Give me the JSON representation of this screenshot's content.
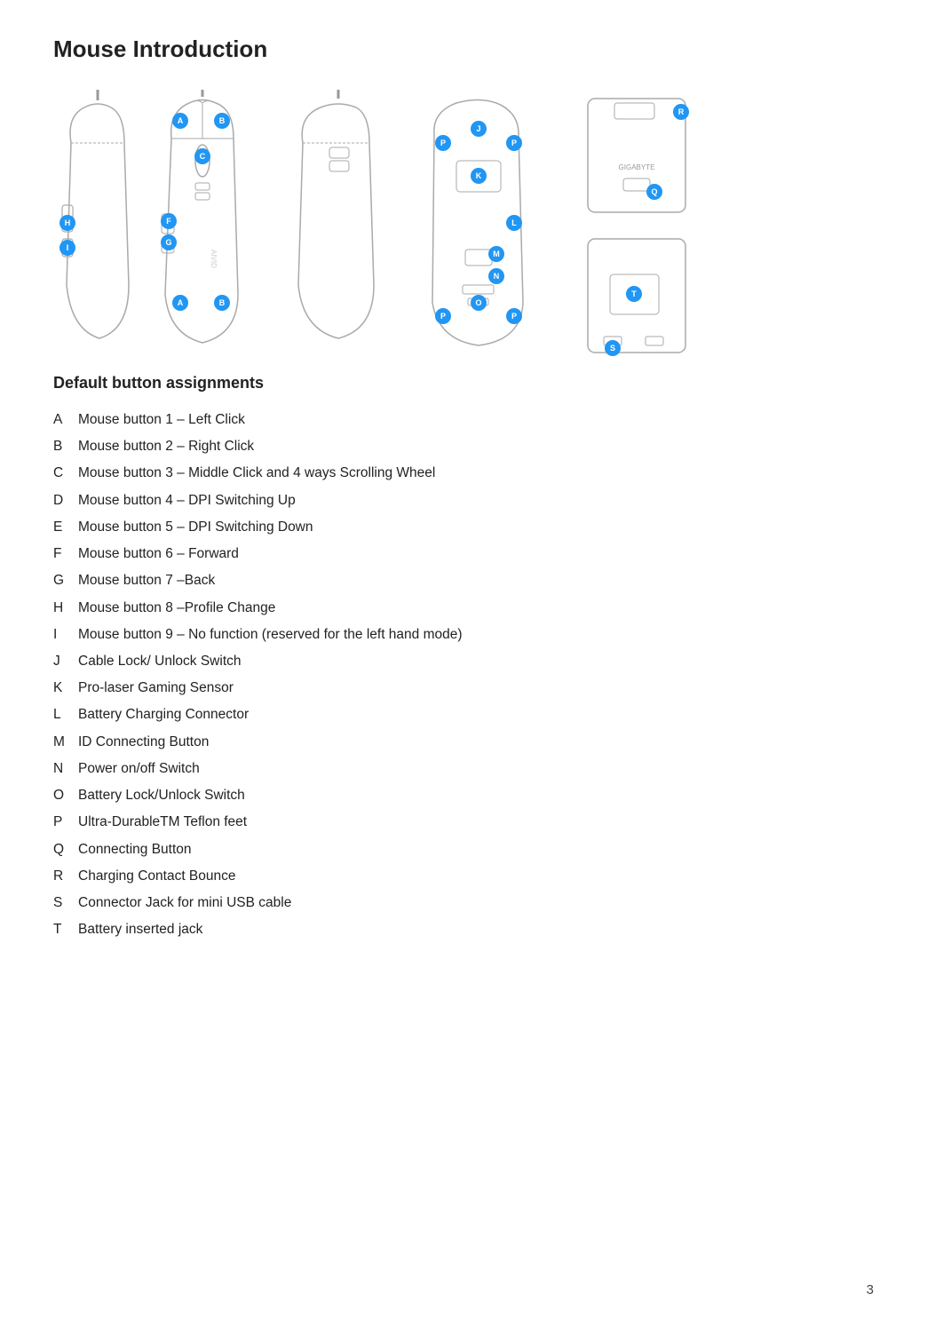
{
  "page": {
    "title": "Mouse Introduction",
    "page_number": "3"
  },
  "assignments": {
    "heading": "Default button assignments",
    "items": [
      {
        "letter": "A",
        "description": "Mouse button 1 – Left Click"
      },
      {
        "letter": "B",
        "description": "Mouse button 2 – Right Click"
      },
      {
        "letter": "C",
        "description": "Mouse button 3 – Middle Click and 4 ways Scrolling Wheel"
      },
      {
        "letter": "D",
        "description": "Mouse button 4 – DPI Switching Up"
      },
      {
        "letter": "E",
        "description": "Mouse button 5 – DPI Switching Down"
      },
      {
        "letter": "F",
        "description": "Mouse button 6 – Forward"
      },
      {
        "letter": "G",
        "description": "Mouse button 7 –Back"
      },
      {
        "letter": "H",
        "description": "Mouse button 8 –Profile Change"
      },
      {
        "letter": "I",
        "description": "Mouse button 9 – No function (reserved for the left hand mode)"
      },
      {
        "letter": "J",
        "description": "Cable Lock/ Unlock Switch"
      },
      {
        "letter": "K",
        "description": "Pro-laser Gaming Sensor"
      },
      {
        "letter": "L",
        "description": "Battery Charging Connector"
      },
      {
        "letter": "M",
        "description": "ID Connecting Button"
      },
      {
        "letter": "N",
        "description": "Power on/off Switch"
      },
      {
        "letter": "O",
        "description": "Battery Lock/Unlock Switch"
      },
      {
        "letter": "P",
        "description": "Ultra-DurableTM Teflon feet"
      },
      {
        "letter": "Q",
        "description": "Connecting Button"
      },
      {
        "letter": "R",
        "description": "Charging Contact Bounce"
      },
      {
        "letter": "S",
        "description": "Connector Jack for mini USB cable"
      },
      {
        "letter": "T",
        "description": "Battery inserted jack"
      }
    ]
  }
}
